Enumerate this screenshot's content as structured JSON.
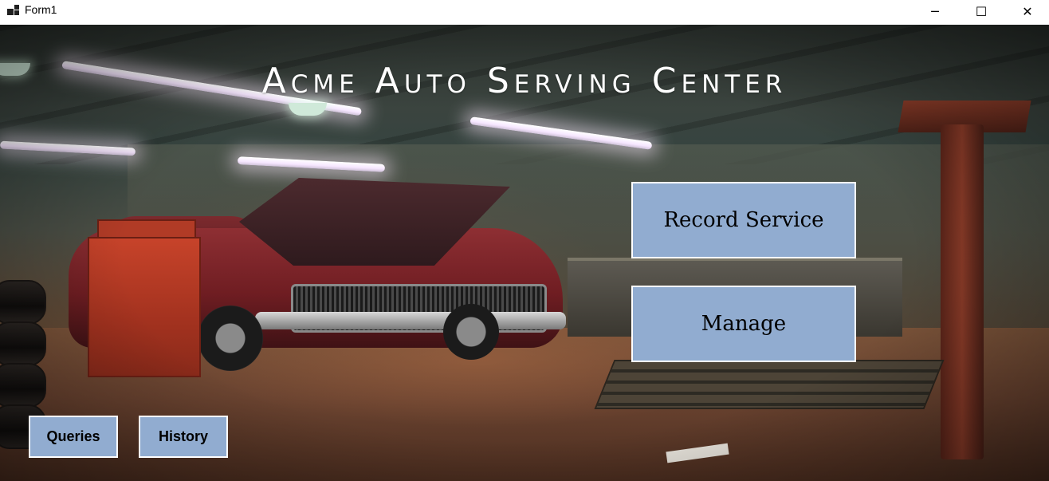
{
  "window": {
    "title": "Form1",
    "icon": "app-icon",
    "controls": {
      "minimize": "─",
      "maximize": "☐",
      "close": "✕"
    }
  },
  "main": {
    "heading": "Acme Auto Serving Center",
    "buttons": {
      "record_service": "Record Service",
      "manage": "Manage",
      "queries": "Queries",
      "history": "History"
    }
  },
  "colors": {
    "button_bg": "#91acd0",
    "button_border": "#ffffff",
    "heading": "#ffffff"
  }
}
